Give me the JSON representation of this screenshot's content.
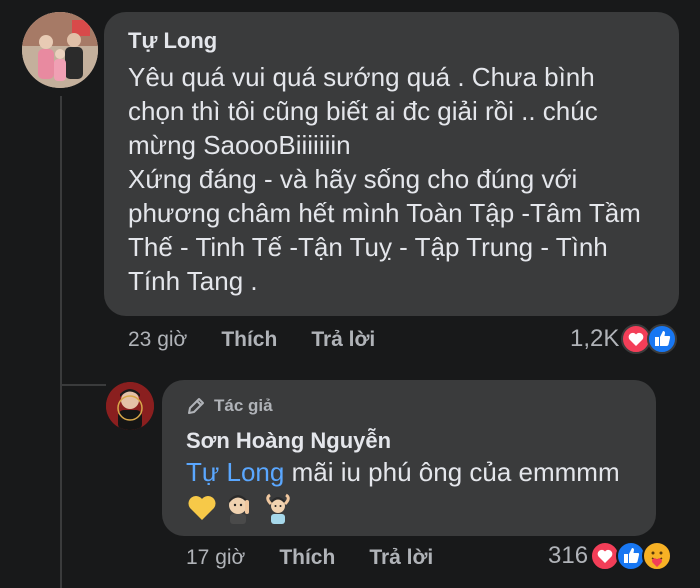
{
  "comment": {
    "author": "Tự Long",
    "text_lines": [
      "Yêu quá vui quá sướng quá . Chưa bình",
      "chọn thì tôi cũng biết ai đc giải rồi .. chúc",
      "mừng SaoooBiiiiiiin",
      "Xứng đáng - và hãy sống cho đúng với",
      "phương châm hết mình Toàn Tập -Tâm Tầm",
      "Thế - Tinh Tế -Tận Tuỵ - Tập Trung - Tình",
      "Tính Tang ."
    ],
    "time": "23 giờ",
    "like_label": "Thích",
    "reply_label": "Trả lời",
    "reaction_count": "1,2K",
    "reactions": [
      "heart",
      "like"
    ]
  },
  "reply": {
    "badge": "Tác giả",
    "author": "Sơn Hoàng Nguyễn",
    "mention": "Tự Long",
    "text": "mãi iu phú ông của emmmm",
    "emojis": [
      "yellow-heart",
      "shh-face",
      "man-gesturing-ok"
    ],
    "time": "17 giờ",
    "like_label": "Thích",
    "reply_label": "Trả lời",
    "reaction_count": "316",
    "reactions": [
      "heart",
      "like",
      "care"
    ]
  },
  "colors": {
    "background": "#18191a",
    "bubble": "#3a3b3c",
    "mention": "#5aa7ff",
    "like_blue": "#1877f2",
    "heart_red": "#f33e58"
  }
}
